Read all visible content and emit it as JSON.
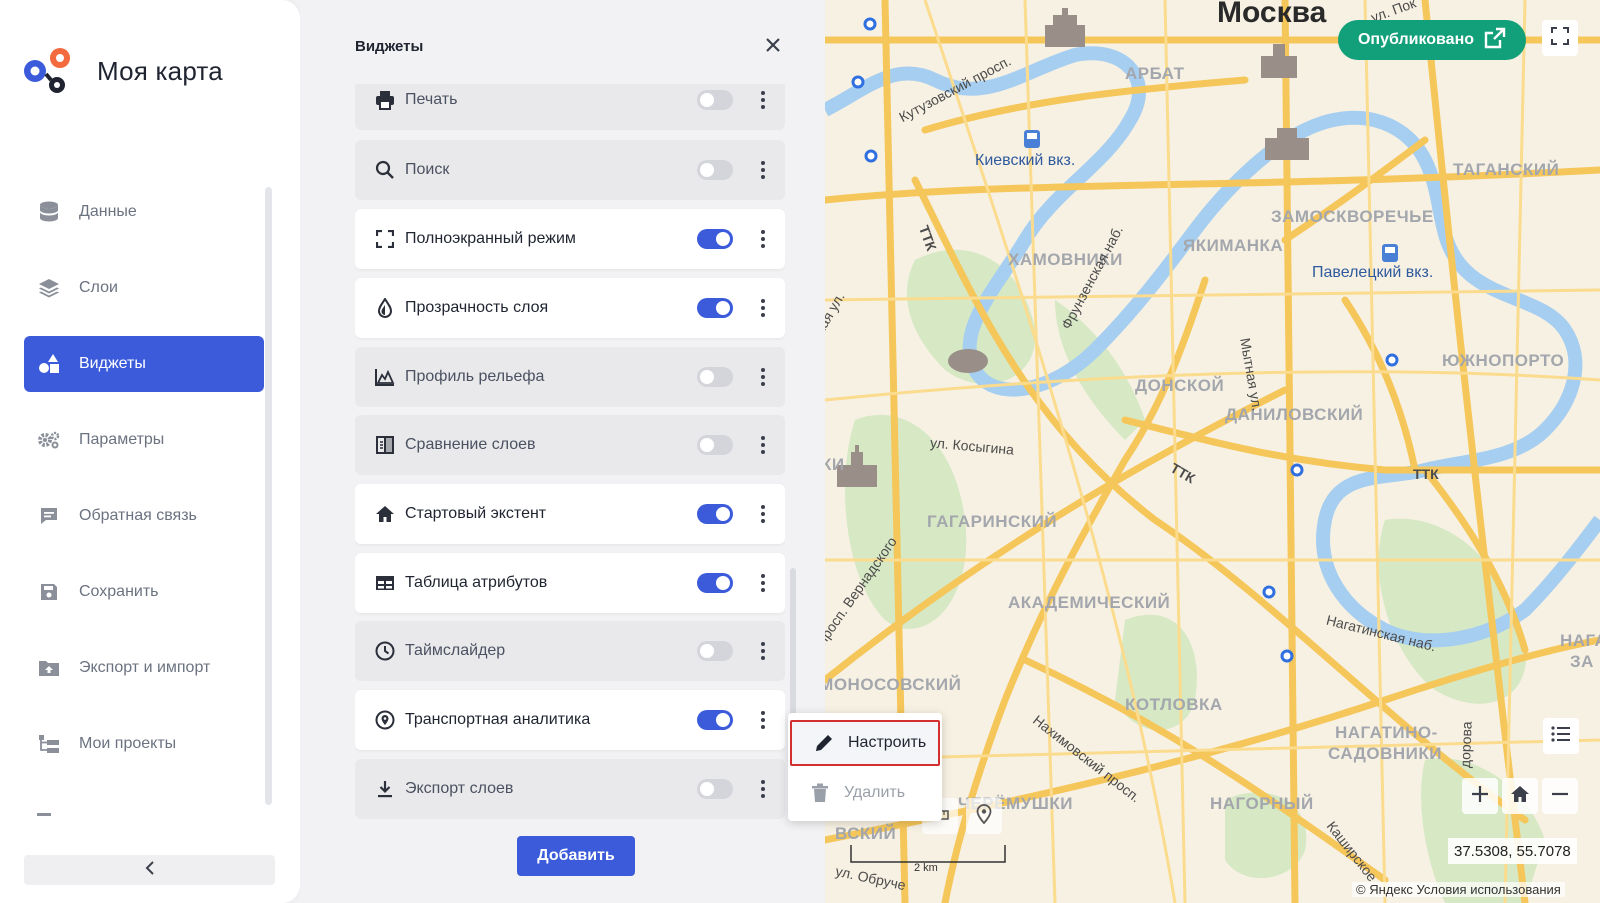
{
  "app": {
    "title": "Моя карта"
  },
  "sidebar": {
    "items": [
      {
        "label": "Данные",
        "icon": "database-icon"
      },
      {
        "label": "Слои",
        "icon": "layers-icon"
      },
      {
        "label": "Виджеты",
        "icon": "widgets-icon",
        "active": true
      },
      {
        "label": "Параметры",
        "icon": "gears-icon"
      },
      {
        "label": "Обратная связь",
        "icon": "feedback-icon"
      },
      {
        "label": "Сохранить",
        "icon": "save-icon"
      },
      {
        "label": "Экспорт и импорт",
        "icon": "folder-upload-icon"
      },
      {
        "label": "Мои проекты",
        "icon": "projects-icon"
      }
    ],
    "collapse_icon": "chevron-left-icon"
  },
  "widgets_panel": {
    "title": "Виджеты",
    "add_button": "Добавить",
    "widgets": [
      {
        "label": "Печать",
        "icon": "print-icon",
        "enabled": false
      },
      {
        "label": "Поиск",
        "icon": "search-icon",
        "enabled": false
      },
      {
        "label": "Полноэкранный режим",
        "icon": "fullscreen-icon",
        "enabled": true
      },
      {
        "label": "Прозрачность слоя",
        "icon": "opacity-icon",
        "enabled": true
      },
      {
        "label": "Профиль рельефа",
        "icon": "elevation-profile-icon",
        "enabled": false
      },
      {
        "label": "Сравнение слоев",
        "icon": "compare-icon",
        "enabled": false
      },
      {
        "label": "Стартовый экстент",
        "icon": "home-icon",
        "enabled": true
      },
      {
        "label": "Таблица атрибутов",
        "icon": "table-icon",
        "enabled": true
      },
      {
        "label": "Таймслайдер",
        "icon": "clock-icon",
        "enabled": false
      },
      {
        "label": "Транспортная аналитика",
        "icon": "location-pin-icon",
        "enabled": true
      },
      {
        "label": "Экспорт слоев",
        "icon": "download-icon",
        "enabled": false
      }
    ]
  },
  "context_menu": {
    "configure": "Настроить",
    "delete": "Удалить"
  },
  "map": {
    "published_button": "Опубликовано",
    "coords": "37.5308, 55.7078",
    "copyright": "© Яндекс Условия использования",
    "scale": "2 km",
    "labels": {
      "city": "Москва",
      "arbat": "АРБАТ",
      "tagansky": "ТАГАНСКИЙ",
      "zamoskvorechye": "ЗАМОСКВОРЕЧЬЕ",
      "yakimanka": "ЯКИМАНКА",
      "khamovniki": "ХАМОВНИКИ",
      "donskoy": "ДОНСКОЙ",
      "danilovsky": "ДАНИЛОВСКИЙ",
      "yuzhnoport": "ЮЖНОПОРТО",
      "gagarinsky": "ГАГАРИНСКИЙ",
      "akademichesky": "АКАДЕМИЧЕСКИЙ",
      "lomonosovsky": "ЛОМОНОСОВСКИЙ",
      "kotlovka": "КОТЛОВКА",
      "nagatino": "НАГАТИНО-",
      "sadovniki": "САДОВНИКИ",
      "nagorny": "НАГОРНЫЙ",
      "cheryomushki": "ЧЕРЁМУШКИ",
      "nagat2": "НАГАТ",
      "za": "ЗА",
      "kiyevsky": "Киевский вкз.",
      "paveletsky": "Павелецкий вкз.",
      "kutuzovsky": "Кутузовский просп.",
      "ttk1": "ТТК",
      "ttk2": "ТТК",
      "ttk3": "ТТК",
      "frunzenskaya": "Фрунзенская наб.",
      "mytnaya": "Мытная ул.",
      "kosygina": "ул. Косыгина",
      "vernadskogo": "просп. Вернадского",
      "nakhimovsky": "Нахимовский просп.",
      "nagatinskaya": "Нагатинская наб.",
      "kashirskoye": "Каширское",
      "ul_pok": "ул. Пок",
      "obruch": "ул. Обруче",
      "vskiy": "ВСКИЙ",
      "ki": "КИ",
      "skaya": "ская ул.",
      "v": "в",
      "dorova": "дорова"
    }
  },
  "colors": {
    "accent": "#3b5bdb",
    "published": "#12a07a",
    "highlight_border": "#d32f2f"
  }
}
